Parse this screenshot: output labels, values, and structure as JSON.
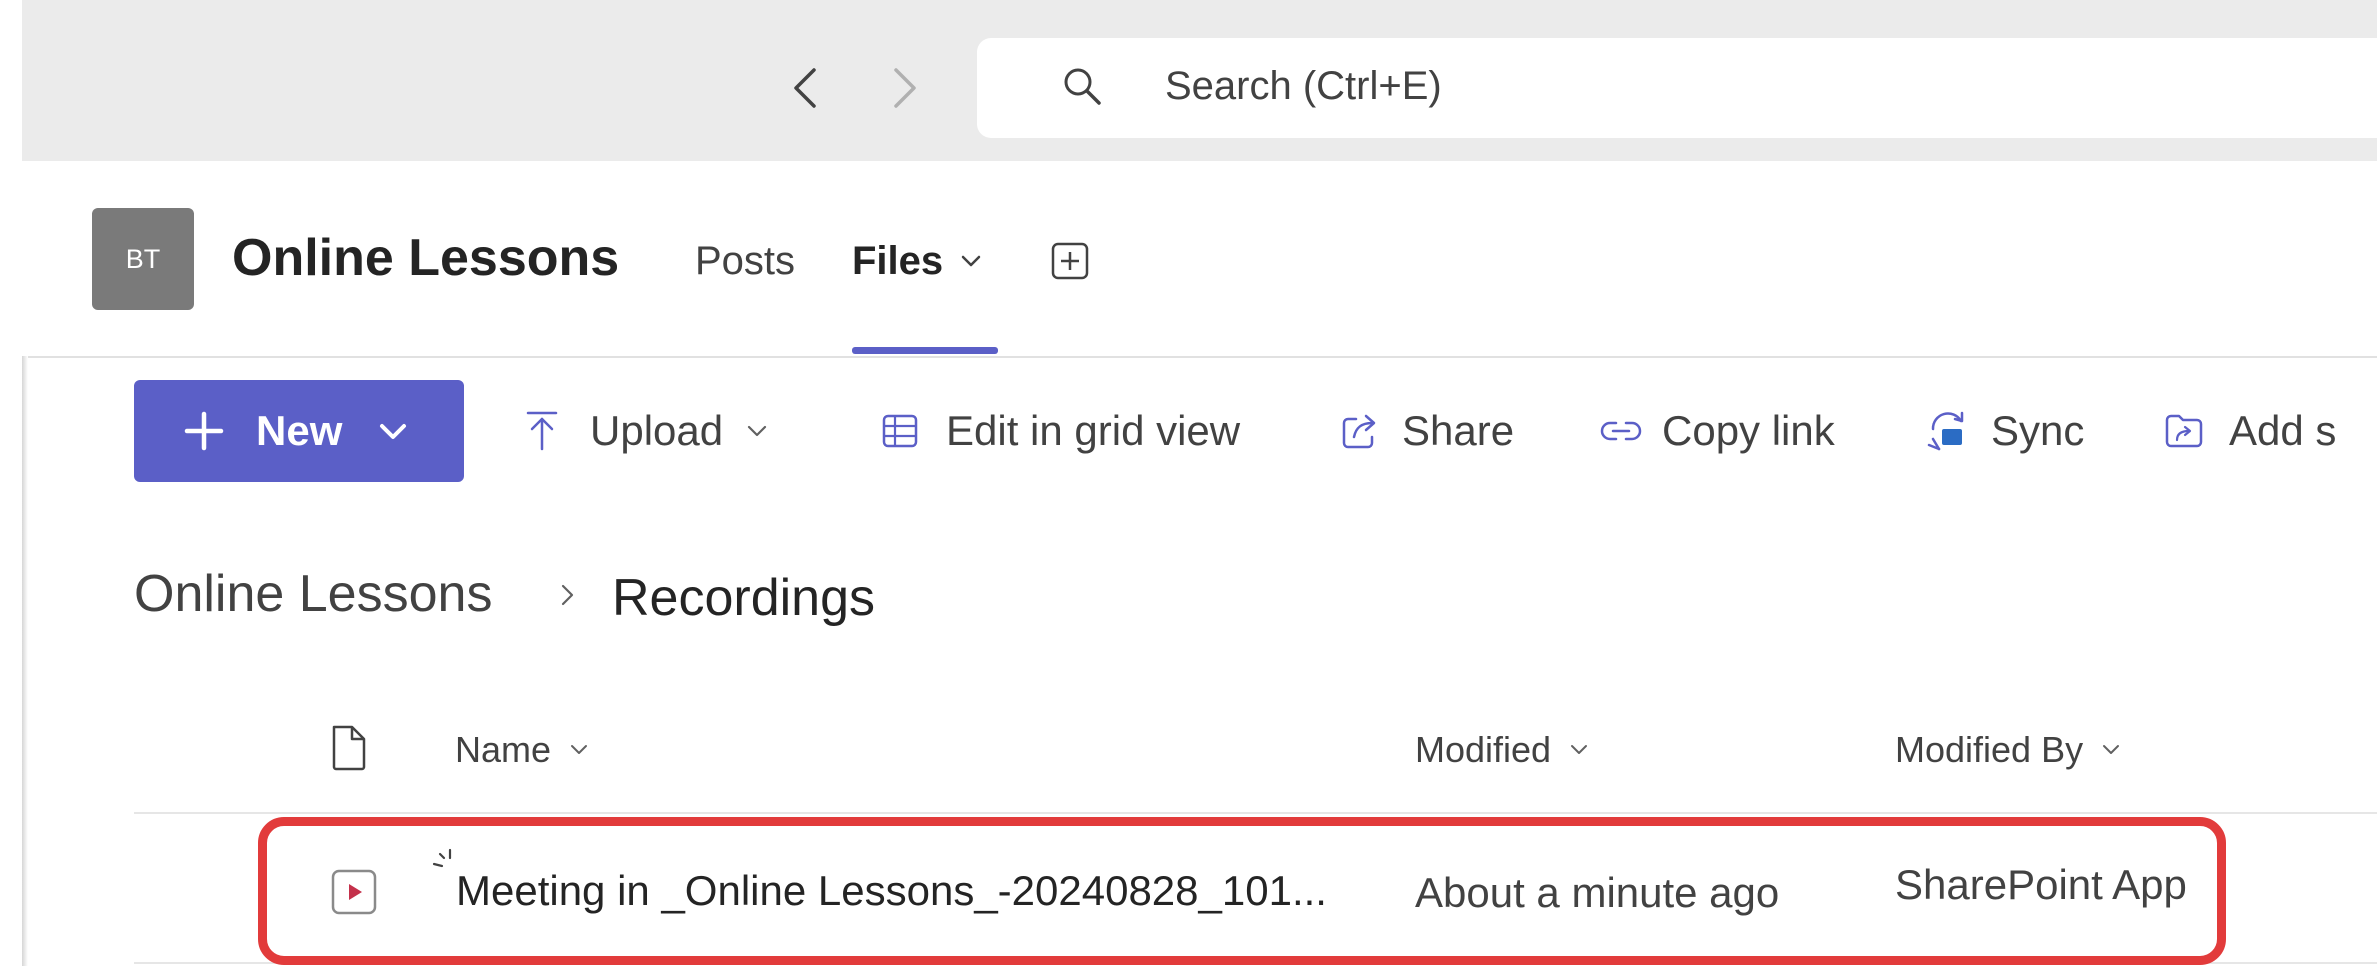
{
  "titlebar": {
    "search_placeholder": "Search (Ctrl+E)"
  },
  "team": {
    "avatar_initials": "BT",
    "name": "Online Lessons",
    "tabs": [
      {
        "label": "Posts"
      },
      {
        "label": "Files",
        "selected": true
      }
    ]
  },
  "commands": {
    "new_label": "New",
    "upload_label": "Upload",
    "grid_label": "Edit in grid view",
    "share_label": "Share",
    "copy_label": "Copy link",
    "sync_label": "Sync",
    "add_shortcut_label": "Add s"
  },
  "breadcrumb": {
    "root": "Online Lessons",
    "current": "Recordings"
  },
  "table": {
    "columns": {
      "name": "Name",
      "modified": "Modified",
      "modified_by": "Modified By"
    },
    "rows": [
      {
        "name": "Meeting in _Online Lessons_-20240828_101...",
        "modified": "About a minute ago",
        "modified_by": "SharePoint App",
        "highlighted": true
      }
    ]
  },
  "colors": {
    "accent": "#5b5fc7",
    "highlight": "#e23b3b",
    "avatar_bg": "#7a7a7a",
    "video_icon": "#c4314b"
  },
  "icons": {
    "back": "chevron-left-icon",
    "forward": "chevron-right-icon",
    "search": "search-icon",
    "add_tab": "add-tab-icon",
    "upload": "upload-icon",
    "grid": "grid-icon",
    "share": "share-icon",
    "copy": "link-icon",
    "sync": "sync-icon",
    "add_shortcut": "add-shortcut-icon",
    "file_type": "file-icon",
    "video": "video-file-icon"
  }
}
